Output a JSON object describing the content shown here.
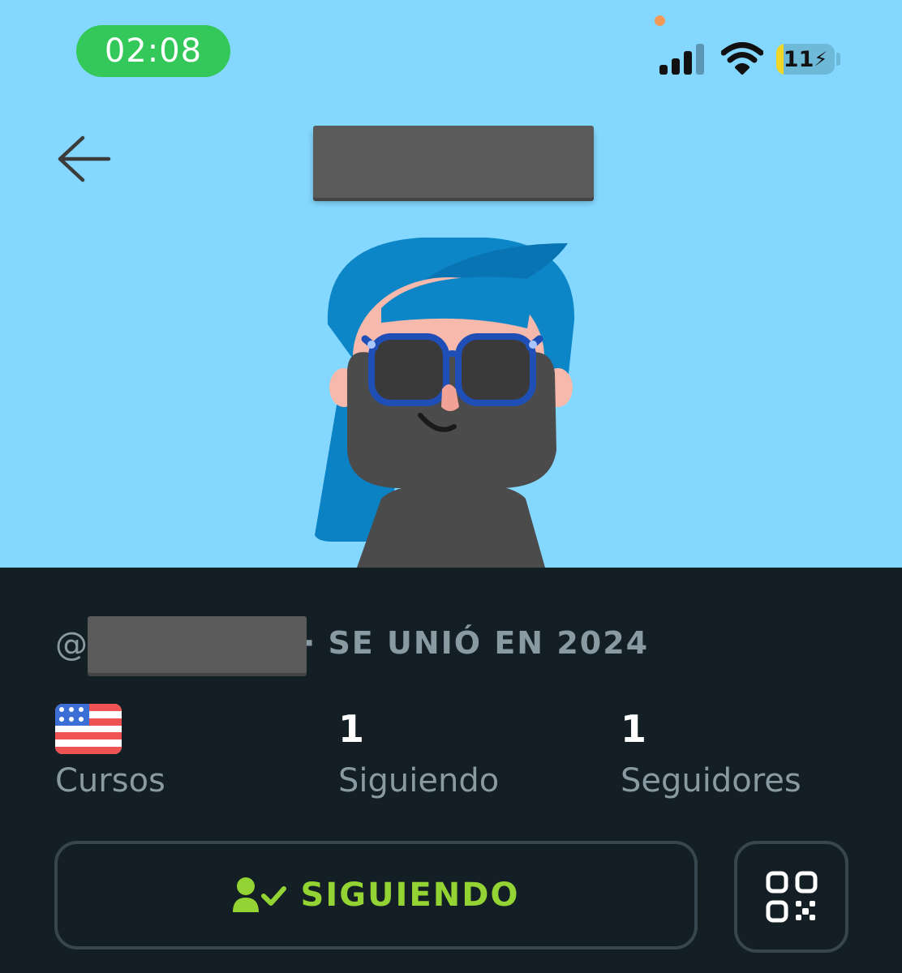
{
  "status_bar": {
    "time": "02:08",
    "battery_level": "11",
    "battery_fraction": 0.11,
    "colors": {
      "time_pill": "#34c759",
      "privacy_dot": "#f29a55",
      "battery_fill": "#f2d72b"
    }
  },
  "header": {
    "back_icon": "arrow-left-icon",
    "display_name_redacted": true
  },
  "profile": {
    "handle_prefix": "@",
    "handle_redacted": true,
    "joined_separator": "·",
    "joined_text": "SE UNIÓ EN 2024",
    "stats": {
      "courses_label": "Cursos",
      "courses_flag_icon": "us-flag-icon",
      "following_value": "1",
      "following_label": "Siguiendo",
      "followers_value": "1",
      "followers_label": "Seguidores"
    }
  },
  "actions": {
    "follow_button_label": "SIGUIENDO",
    "follow_icon": "user-check-icon",
    "qr_icon": "qr-code-icon"
  },
  "colors": {
    "hero_background": "#84d8ff",
    "panel_background": "#131f24",
    "accent_green": "#93d333",
    "muted_text": "#8a9aa2"
  }
}
